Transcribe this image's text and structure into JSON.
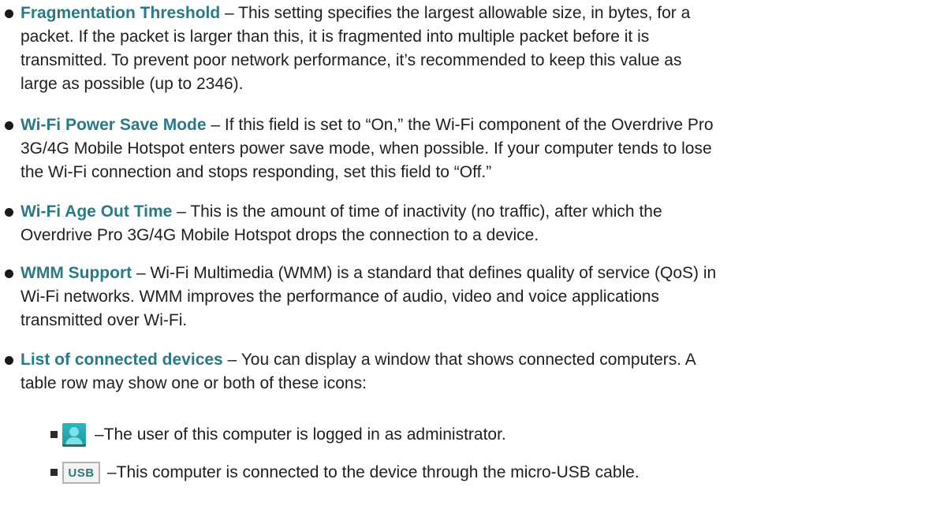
{
  "items": [
    {
      "term": "Fragmentation Threshold",
      "lines": [
        " – This setting specifies the largest allowable size, in bytes, for a",
        "packet. If the packet is larger than this, it is fragmented into multiple packet before it is",
        "transmitted. To prevent poor network performance, it’s recommended to keep this value as",
        "large as possible (up to 2346)."
      ]
    },
    {
      "term": "Wi-Fi Power Save Mode",
      "lines": [
        " – If this field is set to “On,” the Wi-Fi component of the Overdrive Pro",
        "3G/4G Mobile Hotspot enters power save mode, when possible. If your computer tends to lose",
        "the Wi-Fi connection and stops responding, set this field to “Off.”"
      ]
    },
    {
      "term": "Wi-Fi Age Out Time",
      "lines": [
        " – This is the amount of time of inactivity (no traffic), after which the",
        "Overdrive Pro 3G/4G Mobile Hotspot drops the connection to a device."
      ]
    },
    {
      "term": "WMM Support",
      "lines": [
        " – Wi-Fi Multimedia (WMM) is a standard that defines quality of service (QoS) in",
        "Wi-Fi networks. WMM improves the performance of audio, video and voice applications",
        "transmitted over Wi-Fi."
      ]
    },
    {
      "term": "List of connected devices",
      "lines": [
        " – You can display a window that shows connected computers. A",
        "table row may show one or both of these icons:"
      ]
    }
  ],
  "sub_items": [
    {
      "icon": "admin-user-icon",
      "text": "–The user of this computer is logged in as administrator."
    },
    {
      "icon": "usb-icon",
      "icon_label": "USB",
      "text": "–This computer is connected to the device through the micro-USB cable."
    }
  ],
  "colors": {
    "term": "#2a7a86",
    "admin_icon": "#1a9aa5"
  }
}
